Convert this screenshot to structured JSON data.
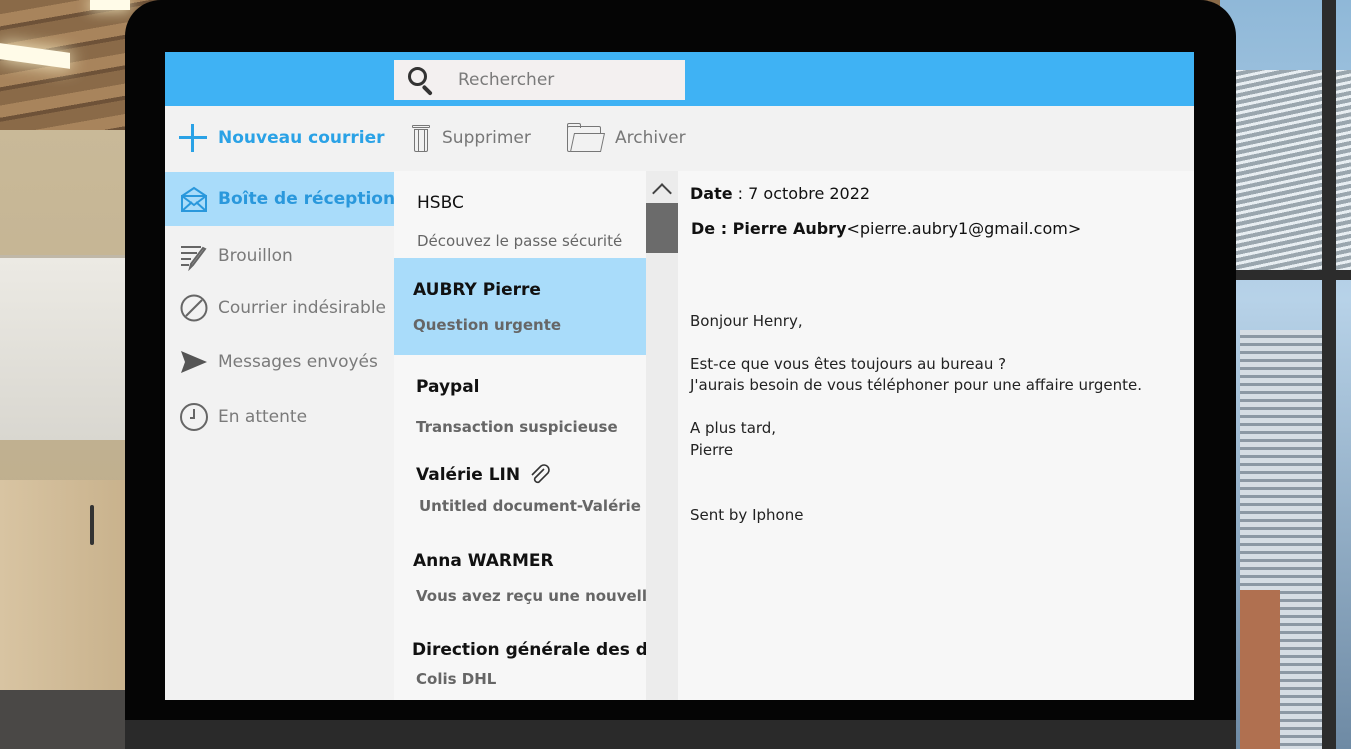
{
  "search": {
    "placeholder": "Rechercher"
  },
  "toolbar": {
    "new_mail": "Nouveau courrier",
    "delete": "Supprimer",
    "archive": "Archiver"
  },
  "sidebar": {
    "items": [
      {
        "label": "Boîte de réception",
        "icon": "inbox-icon",
        "active": true
      },
      {
        "label": "Brouillon",
        "icon": "draft-icon"
      },
      {
        "label": "Courrier indésirable",
        "icon": "spam-icon"
      },
      {
        "label": "Messages envoyés",
        "icon": "sent-icon"
      },
      {
        "label": "En attente",
        "icon": "clock-icon"
      }
    ]
  },
  "messages": [
    {
      "sender": "HSBC",
      "subject": "Découvez le passe sécurité"
    },
    {
      "sender": "AUBRY Pierre",
      "subject": "Question urgente",
      "selected": true
    },
    {
      "sender": "Paypal",
      "subject": "Transaction suspicieuse"
    },
    {
      "sender": "Valérie LIN",
      "subject": "Untitled document-Valérie LI",
      "attachment": true
    },
    {
      "sender": "Anna WARMER",
      "subject": "Vous avez reçu une nouvelle"
    },
    {
      "sender": "Direction générale des dou",
      "subject": "Colis DHL"
    }
  ],
  "email": {
    "date_label": "Date",
    "date_value": ": 7 octobre 2022",
    "from_label": "De : Pierre Aubry",
    "from_address": "<pierre.aubry1@gmail.com>",
    "body": [
      "Bonjour Henry,",
      "Est-ce que vous êtes toujours au bureau ?",
      "J'aurais besoin de vous téléphoner pour une affaire urgente.",
      "A plus tard,",
      "Pierre",
      "Sent by Iphone"
    ]
  },
  "colors": {
    "topbar": "#3fb2f4",
    "accent": "#2aa2e6",
    "selected": "#a9dcfa"
  }
}
